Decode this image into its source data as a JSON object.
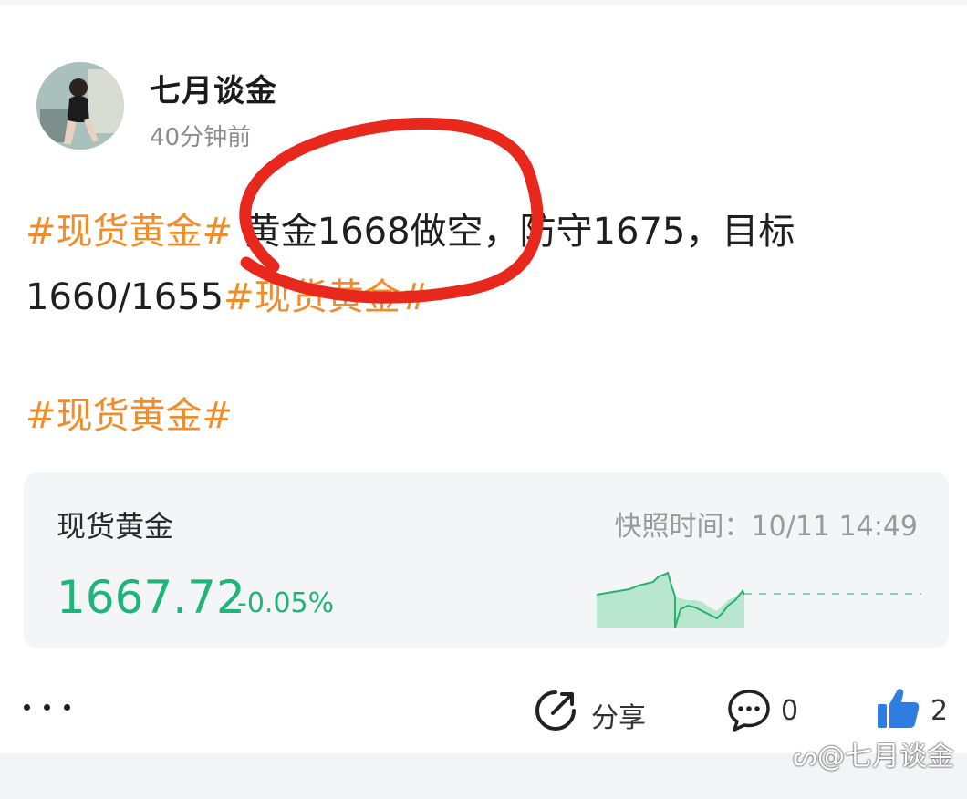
{
  "author": {
    "name": "七月谈金",
    "time": "40分钟前"
  },
  "post": {
    "line1": [
      {
        "text": "#现货黄金#",
        "type": "hashtag"
      },
      {
        "text": " 黄金1668做空，防守1675，目标",
        "type": "text"
      }
    ],
    "line2": [
      {
        "text": "1660/1655",
        "type": "text"
      },
      {
        "text": "#现货黄金#",
        "type": "hashtag"
      }
    ],
    "tag_line": "#现货黄金#"
  },
  "quote_card": {
    "name": "现货黄金",
    "snapshot_label": "快照时间：",
    "snapshot_time": "10/11 14:49",
    "price": "1667.72",
    "change": "-0.05%"
  },
  "actions": {
    "share_label": "分享",
    "comment_count": "0",
    "like_count": "2"
  },
  "watermark": "@七月谈金",
  "colors": {
    "hashtag": "#f08c2a",
    "price_green": "#1fb57a",
    "annotation_red": "#e8281c",
    "like_blue": "#2f7de1"
  },
  "icons": [
    "avatar",
    "more-icon",
    "share-icon",
    "comment-icon",
    "thumbs-up-icon",
    "weibo-icon"
  ]
}
